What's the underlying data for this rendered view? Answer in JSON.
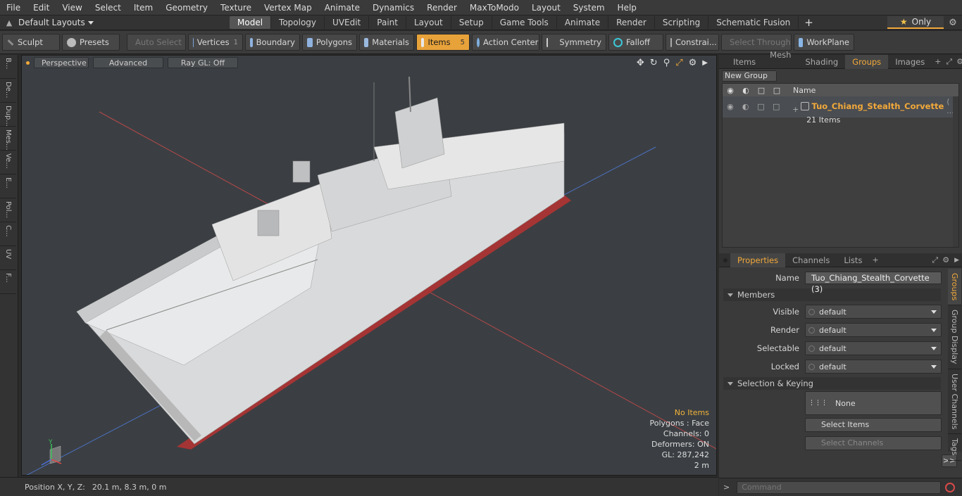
{
  "menu": [
    "File",
    "Edit",
    "View",
    "Select",
    "Item",
    "Geometry",
    "Texture",
    "Vertex Map",
    "Animate",
    "Dynamics",
    "Render",
    "MaxToModo",
    "Layout",
    "System",
    "Help"
  ],
  "layout": {
    "default_layouts": "Default Layouts",
    "tabs": [
      "Model",
      "Topology",
      "UVEdit",
      "Paint",
      "Layout",
      "Setup",
      "Game Tools",
      "Animate",
      "Render",
      "Scripting",
      "Schematic Fusion"
    ],
    "active_tab": "Model",
    "only_label": "Only"
  },
  "toolbar": {
    "sculpt": "Sculpt",
    "presets": "Presets",
    "auto_select": "Auto Select",
    "vertices": "Vertices",
    "vertices_count": "1",
    "boundary": "Boundary",
    "polygons": "Polygons",
    "materials": "Materials",
    "items": "Items",
    "items_count": "5",
    "action_center": "Action Center",
    "symmetry": "Symmetry",
    "falloff": "Falloff",
    "constraints": "Constrai...",
    "select_through": "Select Through",
    "workplane": "WorkPlane"
  },
  "left_tabs": [
    "B...",
    "De...",
    "Dup...",
    "Mes...",
    "Ve...",
    "E...",
    "Pol...",
    "C...",
    "UV",
    "F..."
  ],
  "viewport": {
    "perspective": "Perspective",
    "advanced": "Advanced",
    "raygl": "Ray GL: Off",
    "info": {
      "no_items": "No Items",
      "polygons": "Polygons : Face",
      "channels": "Channels: 0",
      "deformers": "Deformers: ON",
      "gl": "GL: 287,242",
      "scale": "2 m"
    },
    "axis_y": "Y"
  },
  "status": {
    "position_label": "Position X, Y, Z:",
    "position_value": "20.1 m, 8.3 m, 0 m"
  },
  "top_panel": {
    "tabs": [
      "Items",
      "Mesh ...",
      "Shading",
      "Groups",
      "Images"
    ],
    "active_tab": "Groups",
    "new_group": "New Group",
    "col_name": "Name",
    "group_name": "Tuo_Chiang_Stealth_Corvette",
    "group_suffix": "( ...",
    "group_count": "21 Items"
  },
  "properties": {
    "tabs": [
      "Properties",
      "Channels",
      "Lists"
    ],
    "active_tab": "Properties",
    "name_label": "Name",
    "name_value": "Tuo_Chiang_Stealth_Corvette (3)",
    "members_section": "Members",
    "visible_label": "Visible",
    "visible_value": "default",
    "render_label": "Render",
    "render_value": "default",
    "selectable_label": "Selectable",
    "selectable_value": "default",
    "locked_label": "Locked",
    "locked_value": "default",
    "sel_keying_section": "Selection & Keying",
    "none_label": "None",
    "select_items": "Select Items",
    "select_channels": "Select Channels",
    "more": ">>",
    "side_tabs": [
      "Groups",
      "Group Display",
      "User Channels",
      "Tags"
    ]
  },
  "command": {
    "prompt": ">",
    "placeholder": "Command"
  },
  "colors": {
    "accent": "#f2a93a",
    "hull_red": "#b23a3a",
    "viewport_bg": "#3b3f43"
  }
}
